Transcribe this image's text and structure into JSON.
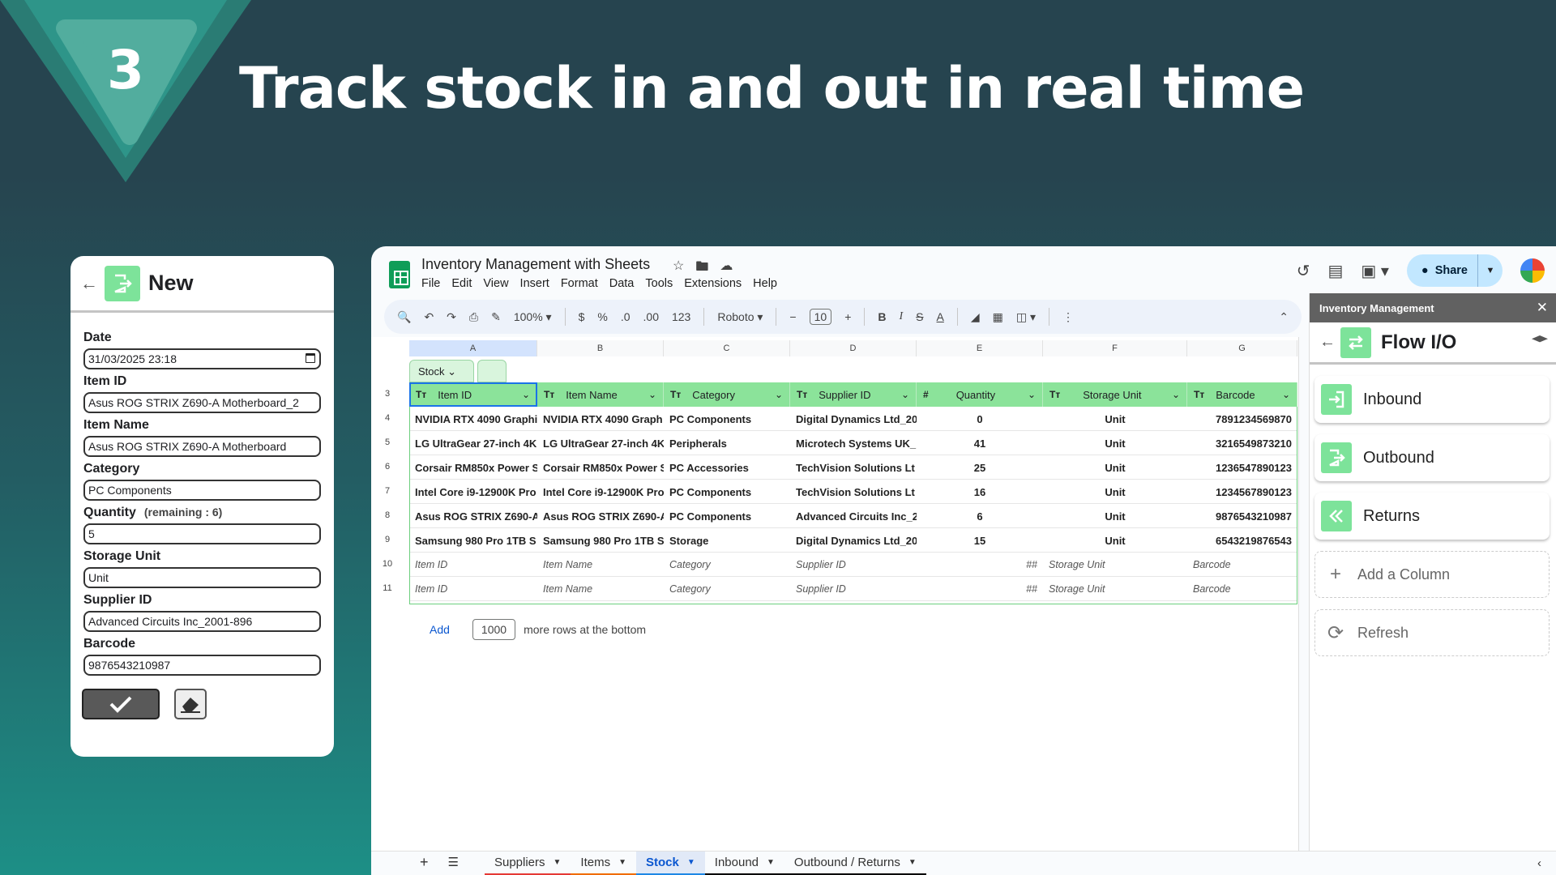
{
  "hero": {
    "step": "3",
    "title": "Track stock in and out in real time"
  },
  "form": {
    "title": "New",
    "fields": [
      {
        "label": "Date",
        "value": "31/03/2025 23:18"
      },
      {
        "label": "Item ID",
        "value": "Asus ROG STRIX Z690-A Motherboard_2"
      },
      {
        "label": "Item Name",
        "value": "Asus ROG STRIX Z690-A Motherboard"
      },
      {
        "label": "Category",
        "value": "PC Components"
      },
      {
        "label": "Quantity",
        "note": "(remaining : 6)",
        "value": "5"
      },
      {
        "label": "Storage Unit",
        "value": "Unit"
      },
      {
        "label": "Supplier ID",
        "value": "Advanced Circuits Inc_2001-896"
      },
      {
        "label": "Barcode",
        "value": "9876543210987"
      }
    ]
  },
  "sheets": {
    "doc_title": "Inventory Management with Sheets",
    "menu": [
      "File",
      "Edit",
      "View",
      "Insert",
      "Format",
      "Data",
      "Tools",
      "Extensions",
      "Help"
    ],
    "share_label": "Share",
    "toolbar": {
      "zoom": "100%",
      "currency": "$",
      "percent": "%",
      "dec_less": ".0",
      "dec_more": ".00",
      "num_format": "123",
      "font": "Roboto",
      "font_size": "10"
    },
    "columns": [
      "A",
      "B",
      "C",
      "D",
      "E",
      "F",
      "G"
    ],
    "table_name": "Stock",
    "header_row_num": "3",
    "headers": [
      {
        "type": "Tт",
        "label": "Item ID"
      },
      {
        "type": "Tт",
        "label": "Item Name"
      },
      {
        "type": "Tт",
        "label": "Category"
      },
      {
        "type": "Tт",
        "label": "Supplier ID"
      },
      {
        "type": "#",
        "label": "Quantity"
      },
      {
        "type": "Tт",
        "label": "Storage Unit"
      },
      {
        "type": "Tт",
        "label": "Barcode"
      }
    ],
    "rows": [
      {
        "num": "4",
        "cells": [
          "NVIDIA RTX 4090 Graphi",
          "NVIDIA RTX 4090 Graph",
          "PC Components",
          "Digital Dynamics Ltd_20",
          "0",
          "Unit",
          "7891234569870"
        ]
      },
      {
        "num": "5",
        "cells": [
          "LG UltraGear 27-inch 4K",
          "LG UltraGear 27-inch 4K",
          "Peripherals",
          "Microtech Systems UK_",
          "41",
          "Unit",
          "3216549873210"
        ]
      },
      {
        "num": "6",
        "cells": [
          "Corsair RM850x Power S",
          "Corsair RM850x Power S",
          "PC Accessories",
          "TechVision Solutions Lt",
          "25",
          "Unit",
          "1236547890123"
        ]
      },
      {
        "num": "7",
        "cells": [
          "Intel Core i9-12900K Pro",
          "Intel Core i9-12900K Pro",
          "PC Components",
          "TechVision Solutions Lt",
          "16",
          "Unit",
          "1234567890123"
        ]
      },
      {
        "num": "8",
        "cells": [
          "Asus ROG STRIX Z690-A",
          "Asus ROG STRIX Z690-A",
          "PC Components",
          "Advanced Circuits Inc_2",
          "6",
          "Unit",
          "9876543210987"
        ]
      },
      {
        "num": "9",
        "cells": [
          "Samsung 980 Pro 1TB S",
          "Samsung 980 Pro 1TB S",
          "Storage",
          "Digital Dynamics Ltd_20",
          "15",
          "Unit",
          "6543219876543"
        ]
      }
    ],
    "placeholder_rows": [
      {
        "num": "10",
        "cells": [
          "Item ID",
          "Item Name",
          "Category",
          "Supplier ID",
          "##",
          "Storage Unit",
          "Barcode"
        ]
      },
      {
        "num": "11",
        "cells": [
          "Item ID",
          "Item Name",
          "Category",
          "Supplier ID",
          "##",
          "Storage Unit",
          "Barcode"
        ]
      }
    ],
    "add_rows": {
      "link": "Add",
      "count": "1000",
      "suffix": "more rows at the bottom"
    },
    "tabs": [
      {
        "label": "Suppliers",
        "color": "#e53935"
      },
      {
        "label": "Items",
        "color": "#ef6c00"
      },
      {
        "label": "Stock",
        "color": "#1e88e5"
      },
      {
        "label": "Inbound",
        "color": "#000000"
      },
      {
        "label": "Outbound / Returns",
        "color": "#000000"
      }
    ]
  },
  "panel": {
    "bar_title": "Inventory Management",
    "title": "Flow I/O",
    "buttons": [
      "Inbound",
      "Outbound",
      "Returns"
    ],
    "add_column": "Add a Column",
    "refresh": "Refresh"
  },
  "colors": {
    "accent_green": "#7de39a",
    "header_green": "#8be39a",
    "share_blue": "#c2e7ff"
  }
}
